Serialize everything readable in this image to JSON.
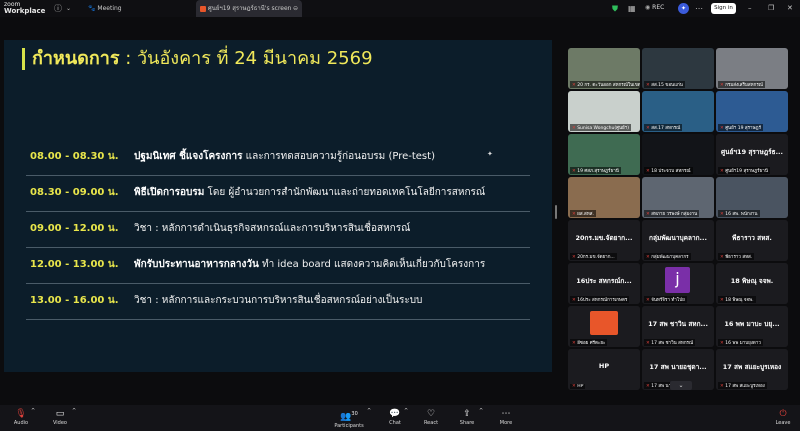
{
  "app": {
    "brand_line1": "zoom",
    "brand_line2": "Workplace"
  },
  "topbar": {
    "tab_meeting": "Meeting",
    "tab_screen": "ศูนย์ฯ19 สุราษฎร์ธานี's screen",
    "rec_label": "REC",
    "signin_label": "Sign in"
  },
  "slide": {
    "title_bold": "กำหนดการ",
    "title_rest": " : วันอังคาร ที่ 24 มีนาคม 2569",
    "rows": [
      {
        "time": "08.00 - 08.30 น.",
        "bold": "ปฐมนิเทศ ชี้แจงโครงการ",
        "rest": " และการทดสอบความรู้ก่อนอบรม (Pre-test)"
      },
      {
        "time": "08.30 - 09.00 น.",
        "bold": "พิธีเปิดการอบรม",
        "rest": " โดย ผู้อำนวยการสำนักพัฒนาและถ่ายทอดเทคโนโลยีการสหกรณ์"
      },
      {
        "time": "09.00 - 12.00 น.",
        "bold": "",
        "rest": "วิชา : หลักการดำเนินธุรกิจสหกรณ์และการบริหารสินเชื่อสหกรณ์"
      },
      {
        "time": "12.00 - 13.00 น.",
        "bold": "พักรับประทานอาหารกลางวัน",
        "rest": " ทำ idea board แสดงความคิดเห็นเกี่ยวกับโครงการ"
      },
      {
        "time": "13.00 - 16.00 น.",
        "bold": "",
        "rest": "วิชา : หลักการและกระบวนการบริหารสินเชื่อสหกรณ์อย่างเป็นระบบ"
      }
    ]
  },
  "participants": [
    {
      "name": "20 กร. ตะวันออก สหกรณ์ในเขต",
      "big": "",
      "scene": "#6d7a66"
    },
    {
      "name": "สส.15 ขอนแก่น",
      "big": "",
      "scene": "#2d3840"
    },
    {
      "name": "กรมส่งเสริมสหกรณ์",
      "big": "",
      "scene": "#7b7e84"
    },
    {
      "name": "Sunisa Wongchu(ศูนย์ฯ)",
      "big": "",
      "scene": "#c9d0cc"
    },
    {
      "name": "สส.17 สหกรณ์",
      "big": "",
      "scene": "#2a5f86"
    },
    {
      "name": "ศูนย์ฯ 19 สุราษฎร์",
      "big": "",
      "scene": "#2d5b93"
    },
    {
      "name": "19 ศสภ.สุราษฎร์ธานี",
      "big": "",
      "scene": "#3f6b52"
    },
    {
      "name": "18 ประจวบ สหกรณ์",
      "big": "",
      "scene": "#121418"
    },
    {
      "name": "ศูนย์ฯ19 สุราษฎร์ธานี",
      "big": "ศูนย์ฯ19 สุราษฎร์ธ...",
      "scene": "#1b1b1f"
    },
    {
      "name": "ผส.สหส.",
      "big": "",
      "scene": "#8a6c4f"
    },
    {
      "name": "สหภาย วรพงษ์ กลุ่มงาน",
      "big": "",
      "scene": "#5e6671"
    },
    {
      "name": "16 สพ. พนักงาน",
      "big": "",
      "scene": "#4a5461"
    },
    {
      "name": "20กร.มข.จัดยาก...",
      "big": "20กร.มข.จัดยาก...",
      "scene": "#1b1b1f"
    },
    {
      "name": "กลุ่มพัฒนาบุคลากร",
      "big": "กลุ่มพัฒนาบุคลาก...",
      "scene": "#1b1b1f"
    },
    {
      "name": "พีธาราว สหส.",
      "big": "พีธาราว สหส.",
      "scene": "#1b1b1f"
    },
    {
      "name": "16ประ สหกรณ์การเกษตร",
      "big": "16ประ สหกรณ์ก...",
      "scene": "#1b1b1f"
    },
    {
      "name": "จันทร์จิรา ทำโป่ย",
      "big": "",
      "scene": "#1b1b1f"
    },
    {
      "name": "18 พิษณุ จจพ.",
      "big": "18 พิษณุ จจพ.",
      "scene": "#1b1b1f"
    },
    {
      "name": "อีซอย ศรีตะยะ",
      "big": "",
      "scene": "#1b1b1f"
    },
    {
      "name": "17 สพ ชาวิน สหกรณ์",
      "big": "17 สพ ชาวิน สหก...",
      "scene": "#1b1b1f"
    },
    {
      "name": "16 พพ มาบยุงดาว",
      "big": "16 พพ มาบะ บยุ...",
      "scene": "#1b1b1f"
    },
    {
      "name": "HP",
      "big": "HP",
      "scene": "#1b1b1f"
    },
    {
      "name": "17 สพ นายอชุดา",
      "big": "17 สพ นายอชุดา...",
      "scene": "#1b1b1f"
    },
    {
      "name": "17 สพ สแยะบูรเหอง",
      "big": "17 สพ สแยะบูรเหอง",
      "scene": "#1b1b1f"
    }
  ],
  "avatar_j": {
    "letter": "j",
    "color": "#7a2fa8"
  },
  "avatar_orange": {
    "color": "#e8562a"
  },
  "controls": {
    "audio": "Audio",
    "video": "Video",
    "participants": "Participants",
    "participants_count": "30",
    "chat": "Chat",
    "react": "React",
    "share": "Share",
    "more": "More",
    "leave": "Leave"
  }
}
